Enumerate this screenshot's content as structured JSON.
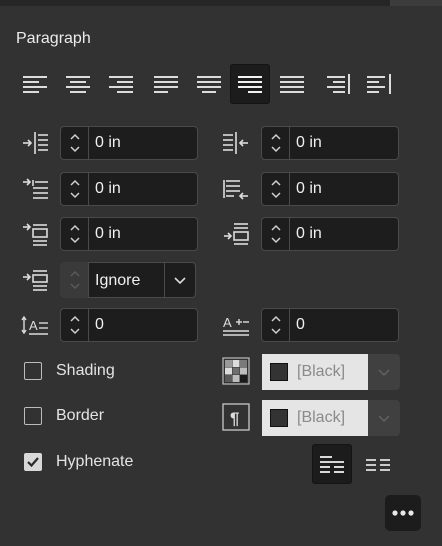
{
  "panel": {
    "title": "Paragraph"
  },
  "alignment": {
    "buttons": [
      {
        "name": "align-left",
        "icon": "align-left-icon"
      },
      {
        "name": "align-center",
        "icon": "align-center-icon"
      },
      {
        "name": "align-right",
        "icon": "align-right-icon"
      },
      {
        "name": "justify-left",
        "icon": "justify-left-icon"
      },
      {
        "name": "justify-center",
        "icon": "justify-center-icon"
      },
      {
        "name": "justify-right",
        "icon": "justify-right-icon",
        "active": true
      },
      {
        "name": "justify-all",
        "icon": "justify-all-icon"
      },
      {
        "name": "align-towards-spine",
        "icon": "align-towards-spine-icon"
      },
      {
        "name": "align-away-from-spine",
        "icon": "align-away-from-spine-icon"
      }
    ]
  },
  "fields": {
    "left_indent": "0 in",
    "right_indent": "0 in",
    "first_line_indent": "0 in",
    "last_line_right_indent": "0 in",
    "space_before": "0 in",
    "space_after": "0 in",
    "space_between_paragraphs": "Ignore",
    "drop_cap_lines": "0",
    "drop_cap_characters": "0"
  },
  "options": {
    "shading": {
      "label": "Shading",
      "checked": false,
      "color": "[Black]"
    },
    "border": {
      "label": "Border",
      "checked": false,
      "color": "[Black]"
    },
    "hyphenate": {
      "label": "Hyphenate",
      "checked": true
    }
  },
  "colors": {
    "background": "#323232",
    "field": "#1d1d1d",
    "field_border": "#4a4a4a",
    "active_button": "#1c1c1c"
  }
}
